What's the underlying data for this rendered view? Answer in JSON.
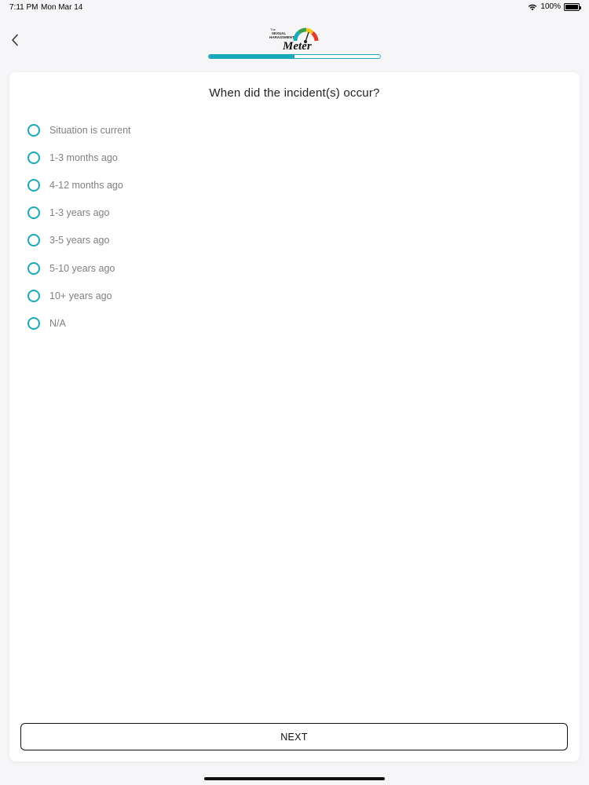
{
  "status_bar": {
    "time": "7:11 PM",
    "date": "Mon Mar 14",
    "battery": "100%"
  },
  "header": {
    "back_icon": "chevron-left-icon",
    "logo": {
      "line1": "The",
      "line2": "SEXUAL",
      "line3": "HARASSMENT",
      "word": "Meter",
      "gauge_colors": [
        "#e23a2c",
        "#f5c31b",
        "#37a24a",
        "#1aa9b8"
      ]
    },
    "progress_fraction": 0.5,
    "accent_color": "#1aa9b8"
  },
  "question": "When did the incident(s) occur?",
  "options": [
    "Situation is current",
    "1-3 months ago",
    "4-12 months ago",
    "1-3 years ago",
    "3-5 years ago",
    "5-10 years ago",
    "10+ years ago",
    "N/A"
  ],
  "next_label": "NEXT"
}
